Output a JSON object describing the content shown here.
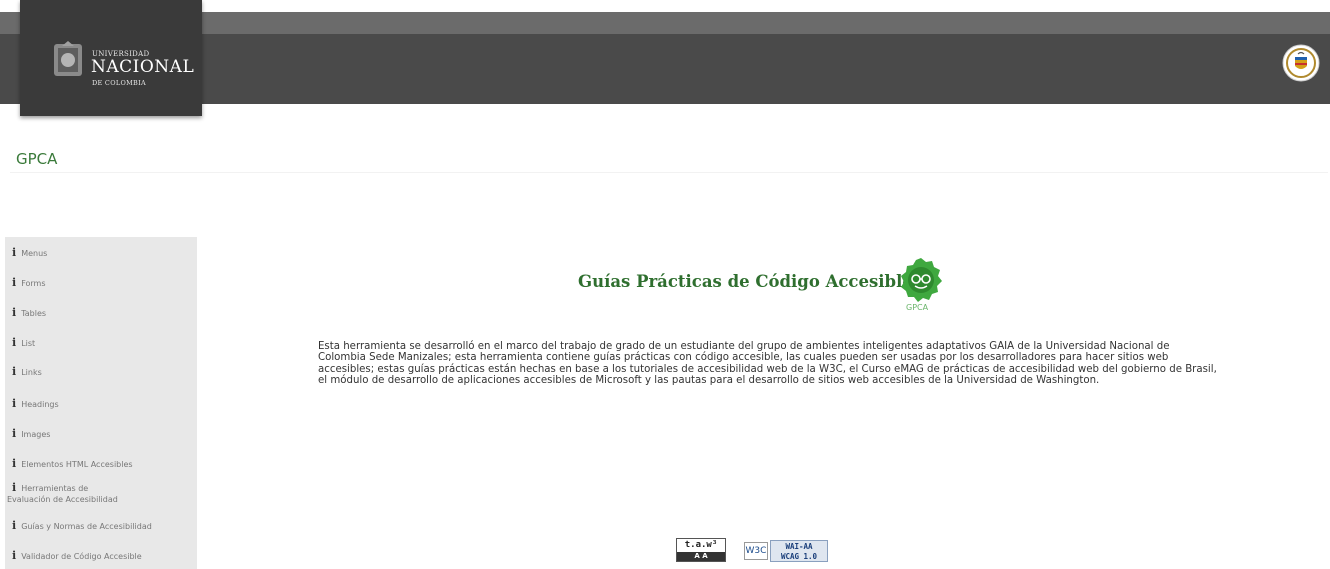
{
  "header": {
    "logo_line1": "UNIVERSIDAD",
    "logo_line2": "NACIONAL",
    "logo_line3": "DE COLOMBIA"
  },
  "site_title": "GPCA",
  "sidebar": {
    "items": [
      {
        "label": "Menus"
      },
      {
        "label": "Forms"
      },
      {
        "label": "Tables"
      },
      {
        "label": "List"
      },
      {
        "label": "Links"
      },
      {
        "label": "Headings"
      },
      {
        "label": "Images"
      },
      {
        "label": "Elementos HTML Accesibles"
      },
      {
        "label": "Herramientas de",
        "label2": "Evaluación de Accesibilidad"
      },
      {
        "label": "Guías y Normas de Accesibilidad"
      },
      {
        "label": "Validador de Código Accesible"
      }
    ]
  },
  "main": {
    "heading": "Guías Prácticas de Código Accesible",
    "logo_caption": "GPCA",
    "paragraph": "Esta herramienta se desarrolló en el marco del trabajo de grado de un estudiante del grupo de ambientes inteligentes adaptativos GAIA de la Universidad Nacional de Colombia Sede Manizales; esta herramienta contiene guías prácticas con código accesible, las cuales pueden ser usadas por los desarrolladores para hacer sitios web accesibles; estas guías prácticas están hechas en base a los tutoriales de accesibilidad web de la W3C, el Curso eMAG de prácticas de accesibilidad web del gobierno de Brasil, el módulo de desarrollo de aplicaciones accesibles de Microsoft y las pautas para el desarrollo de sitios web accesibles de la Universidad de Washington."
  },
  "badges": {
    "taw_top": "t.a.w³",
    "taw_bottom": "A A",
    "w3c": "W3C",
    "wai_line1": "WAI-AA",
    "wai_line2": "WCAG 1.0"
  },
  "colors": {
    "header_bg": "#4a4a4a",
    "logo_bg": "#3a3a3a",
    "accent_green": "#2f6f2f",
    "sidebar_bg": "#e8e8e8"
  }
}
